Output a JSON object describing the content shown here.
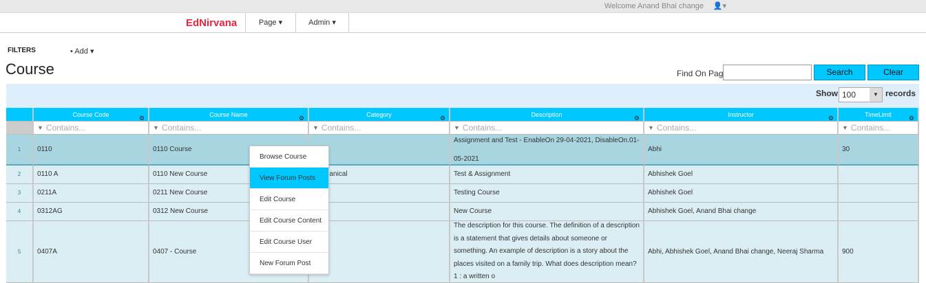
{
  "header": {
    "welcome": "Welcome Anand Bhai change",
    "user_icon": "user-icon"
  },
  "nav": {
    "brand": "EdNirvana",
    "items": [
      "Page ▾",
      "Admin ▾"
    ]
  },
  "filters": {
    "label": "FILTERS",
    "add": "Add ▾"
  },
  "page_title": "Course",
  "find": {
    "label": "Find On Page",
    "value": "",
    "search": "Search",
    "clear": "Clear"
  },
  "pager": {
    "show": "Show",
    "value": "100",
    "records": "records"
  },
  "grid": {
    "columns": [
      "Course Code",
      "Course Name",
      "Category",
      "Description",
      "Instructor",
      "TimeLimit"
    ],
    "filter_placeholder": "Contains...",
    "rows": [
      {
        "n": "1",
        "code": "0110",
        "name": "0110 Course",
        "category": "",
        "description": "Assignment and Test - EnableOn 29-04-2021, DisableOn.01-05-2021",
        "instructor": "Abhi",
        "time": "30"
      },
      {
        "n": "2",
        "code": "0110 A",
        "name": "0110 New Course",
        "category": "Mechanical",
        "description": "Test & Assignment",
        "instructor": "Abhishek Goel",
        "time": ""
      },
      {
        "n": "3",
        "code": "0211A",
        "name": "0211 New Course",
        "category": "",
        "description": "Testing Course",
        "instructor": "Abhishek Goel",
        "time": ""
      },
      {
        "n": "4",
        "code": "0312AG",
        "name": "0312 New Course",
        "category": "",
        "description": "New Course",
        "instructor": "Abhishek Goel, Anand Bhai change",
        "time": ""
      },
      {
        "n": "5",
        "code": "0407A",
        "name": "0407 - Course",
        "category": "",
        "description": "The description for this course. The definition of a description is a statement that gives details about someone or something. An example of description is a story about the places visited on a family trip. What does description mean? 1 : a written o",
        "instructor": "Abhi, Abhishek Goel, Anand Bhai change, Neeraj Sharma",
        "time": "900"
      }
    ]
  },
  "context_menu": {
    "items": [
      "Browse Course",
      "View Forum Posts",
      "Edit Course",
      "Edit Course Content",
      "Edit Course User",
      "New Forum Post"
    ],
    "active": 1
  }
}
